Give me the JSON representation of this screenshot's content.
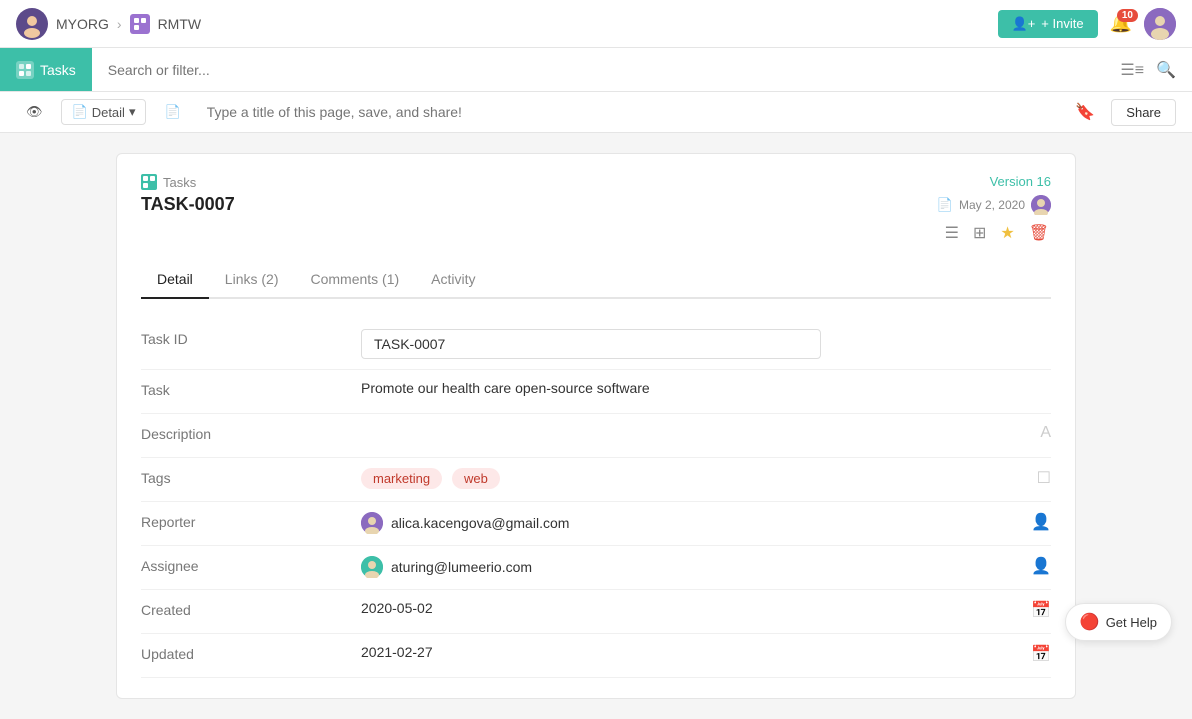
{
  "topnav": {
    "org": "MYORG",
    "project": "RMTW",
    "invite_label": "+ Invite",
    "notif_count": "10"
  },
  "searchbar": {
    "tab_label": "Tasks",
    "placeholder": "Search or filter..."
  },
  "toolbar": {
    "detail_label": "Detail",
    "title_placeholder": "Type a title of this page, save, and share!",
    "share_label": "Share"
  },
  "card": {
    "breadcrumb": "Tasks",
    "task_id": "TASK-0007",
    "version": "Version 16",
    "date": "May 2, 2020",
    "tabs": [
      {
        "label": "Detail",
        "active": true
      },
      {
        "label": "Links (2)",
        "active": false
      },
      {
        "label": "Comments (1)",
        "active": false
      },
      {
        "label": "Activity",
        "active": false
      }
    ],
    "fields": {
      "task_id_label": "Task ID",
      "task_id_value": "TASK-0007",
      "task_label": "Task",
      "task_value": "Promote our health care open-source software",
      "description_label": "Description",
      "tags_label": "Tags",
      "tags": [
        "marketing",
        "web"
      ],
      "reporter_label": "Reporter",
      "reporter_value": "alica.kacengova@gmail.com",
      "assignee_label": "Assignee",
      "assignee_value": "aturing@lumeerio.com",
      "created_label": "Created",
      "created_value": "2020-05-02",
      "updated_label": "Updated",
      "updated_value": "2021-02-27"
    }
  },
  "help": {
    "label": "Get Help"
  }
}
